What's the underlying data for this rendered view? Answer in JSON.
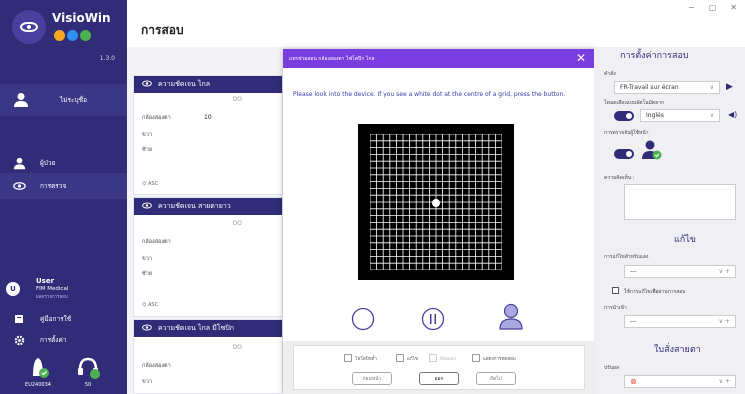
{
  "app": {
    "brand": "VisioWin",
    "version": "1.3.0",
    "page_title": "การสอบ"
  },
  "window": {
    "minimize": "−",
    "maximize": "▢",
    "close": "✕"
  },
  "sidebar": {
    "patient_label": "ไม่ระบุชื่อ",
    "admin_label": "ผู้ป่วย",
    "exam_label": "การตรวจ",
    "user_name": "User",
    "user_org": "FIM Medical",
    "user_role": "ผลตรวจการสอบ",
    "user_initial": "U",
    "manual_label": "คู่มือการใช้",
    "settings_label": "การตั้งค่า",
    "device_id": "EU240034",
    "device_count": "50",
    "colors": {
      "bg": "#302c78",
      "dot1": "#f4a623",
      "dot2": "#2e8ff0",
      "dot3": "#4caf50"
    }
  },
  "cards": [
    {
      "title": "ความชัดเจน ไกล",
      "rows": [
        "กล้องสองตา",
        "ขวา",
        "ซ้าย"
      ],
      "value": "10",
      "footer": "ASC",
      "oo": "OO"
    },
    {
      "title": "ความชัดเจน สายตายาว",
      "rows": [
        "กล้องสองตา",
        "ขวา",
        "ซ้าย"
      ],
      "value": "",
      "footer": "ASC",
      "oo": "OO"
    },
    {
      "title": "ความชัดเจน ไกล มีโซปิก",
      "rows": [
        "กล้องสองตา",
        "ขวา"
      ],
      "value": "",
      "footer": "",
      "oo": "OO"
    }
  ],
  "dialog": {
    "title": "แทรช่วยสอน กล้องสองตา ไฟโตปิก ไกล",
    "close": "✕",
    "message": "Please look into the device. If you see a white dot at the centre of a grid, press the button.",
    "checkboxes": [
      "ไฟโตปิกต่ำ",
      "แก้ไข",
      "ห้องแสง",
      "แสดงการทดสอบ"
    ],
    "buttons": [
      "ก่อนหน้า",
      "ออก",
      "ถัดไป"
    ]
  },
  "right_panel": {
    "settings_title": "การตั้งค่าการสอบ",
    "language_label": "คำสั่ง",
    "language_value": "FR-Travail sur écran",
    "voice_label": "โหมดเสียงแบบอัตโนมัตลาก",
    "voice_value": "Inglés",
    "auto_label": "การตรวจจับผู้ใช้หน้า",
    "comment_label": "ความคิดเห็น :",
    "correction_title": "แก้ไข",
    "correction_label": "การแก้ไขสำหรับแสง",
    "correction_value": "---",
    "correction_check": "ใช้การแก้ไขเพื่อผ่านการสอบ",
    "type_label": "การนำเข้า",
    "type_value": "---",
    "prescription_title": "ใบสั่งสายตา",
    "result_label": "ปรับผล"
  }
}
